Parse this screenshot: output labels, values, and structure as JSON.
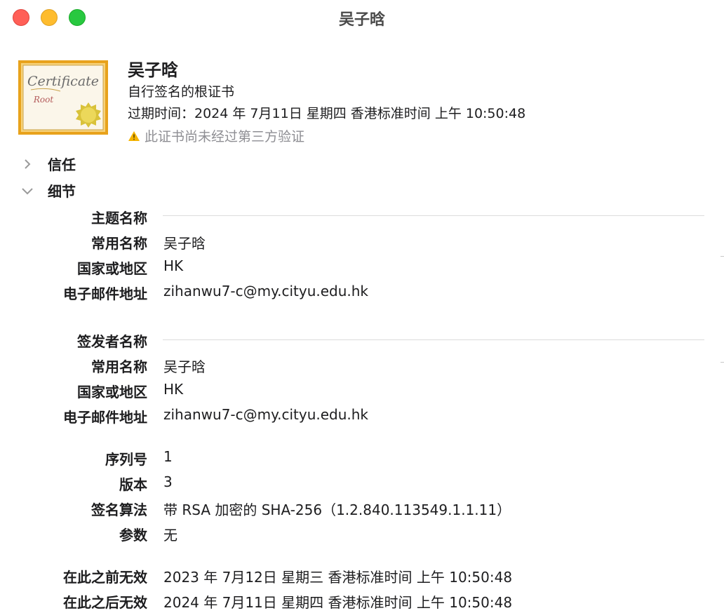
{
  "window": {
    "title": "吴子晗"
  },
  "header": {
    "name": "吴子晗",
    "kind": "自行签名的根证书",
    "expiry": "过期时间：2024 年 7月11日 星期四 香港标准时间 上午 10:50:48",
    "warning": "此证书尚未经过第三方验证",
    "icon_text_1": "Certificate",
    "icon_text_2": "Root"
  },
  "sections": {
    "trust": "信任",
    "details": "细节"
  },
  "subject": {
    "title": "主题名称",
    "cn_label": "常用名称",
    "cn_value": "吴子晗",
    "country_label": "国家或地区",
    "country_value": "HK",
    "email_label": "电子邮件地址",
    "email_value": "zihanwu7-c@my.cityu.edu.hk"
  },
  "issuer": {
    "title": "签发者名称",
    "cn_label": "常用名称",
    "cn_value": "吴子晗",
    "country_label": "国家或地区",
    "country_value": "HK",
    "email_label": "电子邮件地址",
    "email_value": "zihanwu7-c@my.cityu.edu.hk"
  },
  "info": {
    "serial_label": "序列号",
    "serial_value": "1",
    "version_label": "版本",
    "version_value": "3",
    "sigalg_label": "签名算法",
    "sigalg_value": "带 RSA 加密的 SHA-256（1.2.840.113549.1.1.11）",
    "params_label": "参数",
    "params_value": "无"
  },
  "validity": {
    "not_before_label": "在此之前无效",
    "not_before_value": "2023 年 7月12日 星期三 香港标准时间 上午 10:50:48",
    "not_after_label": "在此之后无效",
    "not_after_value": "2024 年 7月11日 星期四 香港标准时间 上午 10:50:48"
  },
  "colors": {
    "close": "#ff5f57",
    "minimize": "#febc2e",
    "maximize": "#28c840",
    "warning": "#f5b400",
    "cert_frame": "#e8a21c"
  }
}
